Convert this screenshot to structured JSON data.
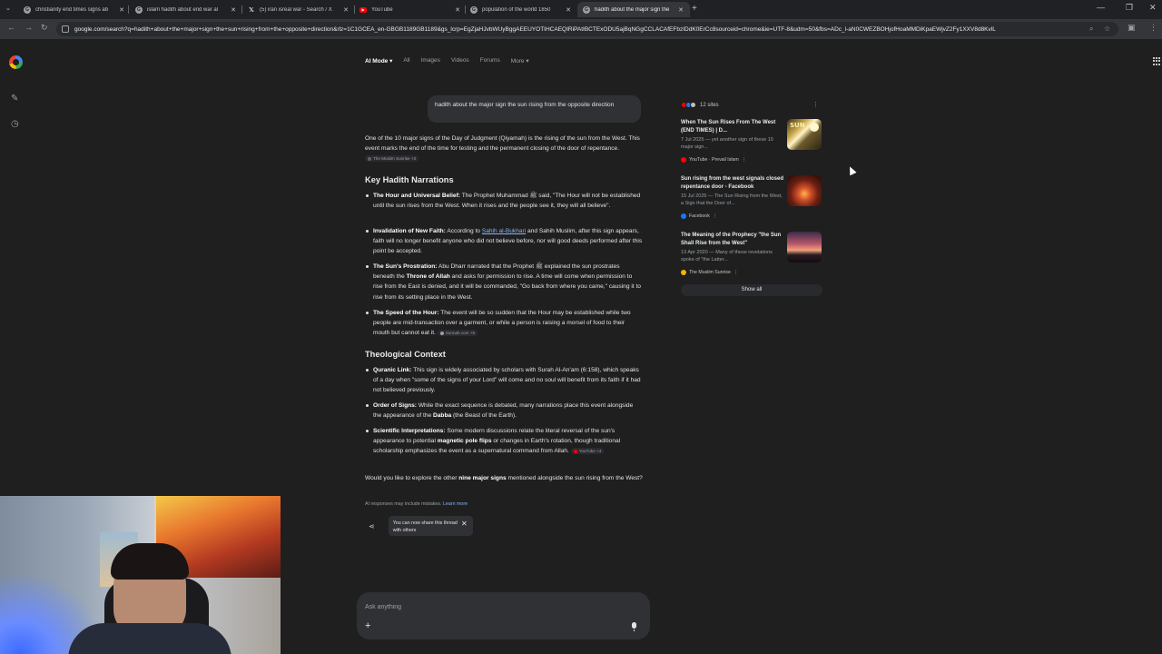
{
  "browser": {
    "tabs": [
      {
        "title": "christianity end times signs ab",
        "icon": "google-icon",
        "active": false
      },
      {
        "title": "islam hadith about end war al",
        "icon": "google-icon",
        "active": false
      },
      {
        "title": "(5) iran isreal war - Search / X",
        "icon": "x-icon",
        "active": false
      },
      {
        "title": "YouTube",
        "icon": "youtube-icon",
        "active": false
      },
      {
        "title": "population of the world 1850",
        "icon": "google-icon",
        "active": false
      },
      {
        "title": "hadith about the major sign the",
        "icon": "google-icon",
        "active": true
      }
    ],
    "url": "google.com/search?q=hadith+about+the+major+sign+the+sun+rising+from+the+opposite+direction&rlz=1C1GCEA_en-GBGB1189GB1189&gs_lcrp=EgZjaHJvbWUyBggAEEUYOTIHCAEQIRiPAtIBCTExODU5ajBqNGgCCLACAfEFbzIDdK0ErCc8sourceid=chrome&ie=UTF-8&udm=50&fbs=ADc_l-aN0CWEZBOHjofHoaMMDiKpaEWjvZ2Fy1XXV8d8KvlL"
  },
  "search": {
    "modes": [
      "AI Mode",
      "All",
      "Images",
      "Videos",
      "Forums",
      "More"
    ],
    "query": "hadith about the major sign the sun rising from the opposite direction"
  },
  "answer": {
    "intro": "One of the 10 major signs of the Day of Judgment (Qiyamah) is the rising of the sun from the West. This event marks the end of the time for testing and the permanent closing of the door of repentance.",
    "intro_cite": "The Muslim Sunrise +3",
    "h_narrations": "Key Hadith Narrations",
    "n1_lead": "The Hour and Universal Belief:",
    "n1_text": " The Prophet Muhammad ﷺ said, \"The Hour will not be established until the sun rises from the West. When it rises and the people see it, they will all believe\".",
    "n2_lead": "Invalidation of New Faith:",
    "n2_pre": " According to ",
    "n2_link": "Sahih al-Bukhari",
    "n2_text": " and Sahih Muslim, after this sign appears, faith will no longer benefit anyone who did not believe before, nor will good deeds performed after this point be accepted.",
    "n3_lead": "The Sun's Prostration:",
    "n3_text1": " Abu Dharr narrated that the Prophet ﷺ explained the sun prostrates beneath the ",
    "n3_bold": "Throne of Allah",
    "n3_text2": " and asks for permission to rise. A time will come when permission to rise from the East is denied, and it will be commanded, \"Go back from where you came,\" causing it to rise from its setting place in the West.",
    "n4_lead": "The Speed of the Hour:",
    "n4_text": " The event will be so sudden that the Hour may be established while two people are mid-transaction over a garment, or while a person is raising a morsel of food to their mouth but cannot eat it.",
    "n4_cite": "Sunnah.com +5",
    "h_context": "Theological Context",
    "c1_lead": "Quranic Link:",
    "c1_text": " This sign is widely associated by scholars with Surah Al-An'am (6:158), which speaks of a day when \"some of the signs of your Lord\" will come and no soul will benefit from its faith if it had not believed previously.",
    "c2_lead": "Order of Signs:",
    "c2_text1": " While the exact sequence is debated, many narrations place this event alongside the appearance of the ",
    "c2_bold": "Dabba",
    "c2_text2": " (the Beast of the Earth).",
    "c3_lead": "Scientific Interpretations:",
    "c3_text1": " Some modern discussions relate the literal reversal of the sun's appearance to potential ",
    "c3_bold": "magnetic pole flips",
    "c3_text2": " or changes in Earth's rotation, though traditional scholarship emphasizes the event as a supernatural command from Allah.",
    "c3_cite": "YouTube +4",
    "followup_pre": "Would you like to explore the other ",
    "followup_bold": "nine major signs",
    "followup_post": " mentioned alongside the sun rising from the West?",
    "disclaimer": "AI responses may include mistakes.",
    "learn_more": "Learn more",
    "share_toast": "You can now share this thread with others"
  },
  "sources": {
    "count_label": "12 sites",
    "items": [
      {
        "title": "When The Sun Rises From The West (END TIMES) | D...",
        "snippet": "7 Jul 2025 — yet another sign of these 10 major sign...",
        "site": "YouTube · Prevail Islam",
        "site_color": "#ff0000",
        "thumb": "sun-west-thumbnail"
      },
      {
        "title": "Sun rising from the west signals closed repentance door - Facebook",
        "snippet": "15 Jul 2025 — The Sun Rising from the West, a Sign that the Door of...",
        "site": "Facebook",
        "site_color": "#1877f2",
        "thumb": "sunset-thumbnail"
      },
      {
        "title": "The Meaning of the Prophecy \"the Sun Shall Rise from the West\"",
        "snippet": "13 Apr 2020 — Many of these revelations spoke of \"the Latter...",
        "site": "The Muslim Sunrise",
        "site_color": "#f4b400",
        "thumb": "horizon-thumbnail"
      }
    ],
    "show_all": "Show all"
  },
  "askbox": {
    "placeholder": "Ask anything"
  },
  "colors": {
    "background": "#1f1f1f",
    "link": "#8ab4f8",
    "panel": "#303134"
  }
}
